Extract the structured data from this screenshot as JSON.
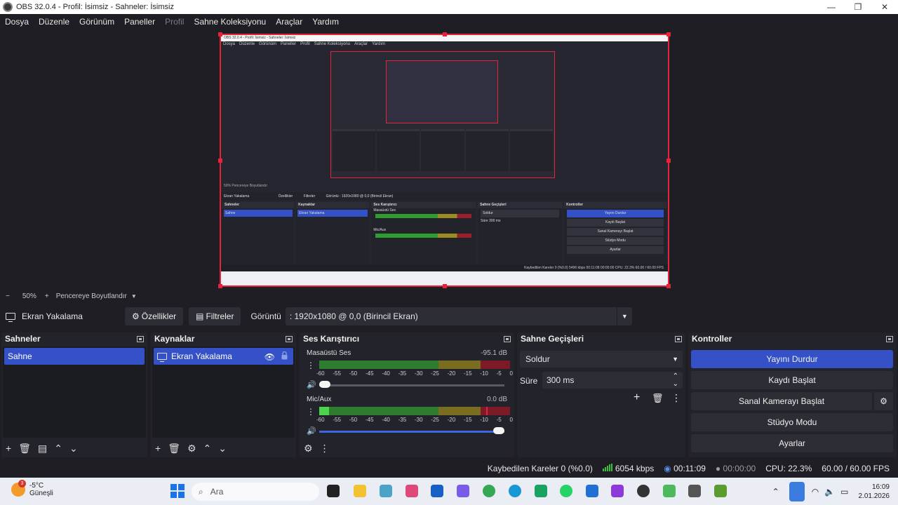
{
  "window": {
    "title": "OBS 32.0.4 - Profil: İsimsiz - Sahneler: İsimsiz",
    "controls": [
      "—",
      "❐",
      "✕"
    ]
  },
  "menu": [
    "Dosya",
    "Düzenle",
    "Görünüm",
    "Paneller",
    "Profil",
    "Sahne Koleksiyonu",
    "Araçlar",
    "Yardım"
  ],
  "zoom": {
    "minus": "−",
    "value": "50%",
    "plus": "+",
    "fit_label": "Pencereye Boyutlandır"
  },
  "source_toolbar": {
    "source_name": "Ekran Yakalama",
    "properties_label": "Özellikler",
    "filters_label": "Filtreler",
    "display_label": "Görüntü",
    "display_value": ": 1920x1080 @ 0,0 (Birincil Ekran)"
  },
  "docks": {
    "scenes": {
      "title": "Sahneler",
      "items": [
        "Sahne"
      ]
    },
    "sources": {
      "title": "Kaynaklar",
      "items": [
        "Ekran Yakalama"
      ]
    },
    "mixer": {
      "title": "Ses Karıştırıcı",
      "channels": [
        {
          "name": "Masaüstü Ses",
          "db": "-95.1 dB",
          "volume": 0.0,
          "level": 0.0
        },
        {
          "name": "Mic/Aux",
          "db": "0.0 dB",
          "volume": 1.0,
          "level": 0.05
        }
      ],
      "ticks": [
        "-60",
        "-55",
        "-50",
        "-45",
        "-40",
        "-35",
        "-30",
        "-25",
        "-20",
        "-15",
        "-10",
        "-5",
        "0"
      ]
    },
    "transitions": {
      "title": "Sahne Geçişleri",
      "selected": "Soldur",
      "duration_label": "Süre",
      "duration_value": "300 ms"
    },
    "controls": {
      "title": "Kontroller",
      "stop_stream": "Yayını Durdur",
      "start_record": "Kaydı Başlat",
      "start_vcam": "Sanal Kamerayı Başlat",
      "studio_mode": "Stüdyo Modu",
      "settings": "Ayarlar"
    }
  },
  "status": {
    "dropped_frames": "Kaybedilen Kareler 0 (%0.0)",
    "bitrate": "6054 kbps",
    "stream_time": "00:11:09",
    "record_time": "00:00:00",
    "cpu": "CPU: 22.3%",
    "fps": "60.00 / 60.00 FPS"
  },
  "taskbar": {
    "weather_temp": "-5°C",
    "weather_desc": "Güneşli",
    "weather_badge": "3",
    "search_placeholder": "Ara",
    "time": "16:09",
    "date": "2.01.2026"
  },
  "nested_preview": {
    "title": "OBS 32.0.4 - Profil: İsimsiz - Sahneler: İsimsiz",
    "menu": [
      "Dosya",
      "Düzenle",
      "Görünüm",
      "Paneller",
      "Profil",
      "Sahne Koleksiyonu",
      "Araçlar",
      "Yardım"
    ],
    "zoom": "50%   Pencereye Boyutlandır",
    "source": "Ekran Yakalama",
    "properties": "Özellikler",
    "filters": "Filtreler",
    "display": "Görüntü   : 1920x1080 @ 0,0 (Birincil Ekran)",
    "scenes": "Sahneler",
    "scene_item": "Sahne",
    "sources": "Kaynaklar",
    "source_item": "Ekran Yakalama",
    "mixer": "Ses Karıştırıcı",
    "desktop": "Masaüstü Ses",
    "mic": "Mic/Aux",
    "transitions": "Sahne Geçişleri",
    "transition": "Soldur",
    "duration": "Süre     300 ms",
    "controls": "Kontroller",
    "stop_stream": "Yayını Durdur",
    "start_record": "Kaydı Başlat",
    "start_vcam": "Sanal Kamerayı Başlat",
    "studio": "Stüdyo Modu",
    "settings": "Ayarlar",
    "status": "Kaybedilen Kareler 0 (%0.0)   5496 kbps   00:11:08   00:00:00   CPU: 22.3%   60.00 / 60.00 FPS"
  },
  "colors": {
    "accent_blue": "#3551c8",
    "record_red": "#e3243a",
    "meter_green": "#2e9c2e",
    "meter_yellow": "#9a8b22",
    "meter_red": "#9c1d2c"
  }
}
